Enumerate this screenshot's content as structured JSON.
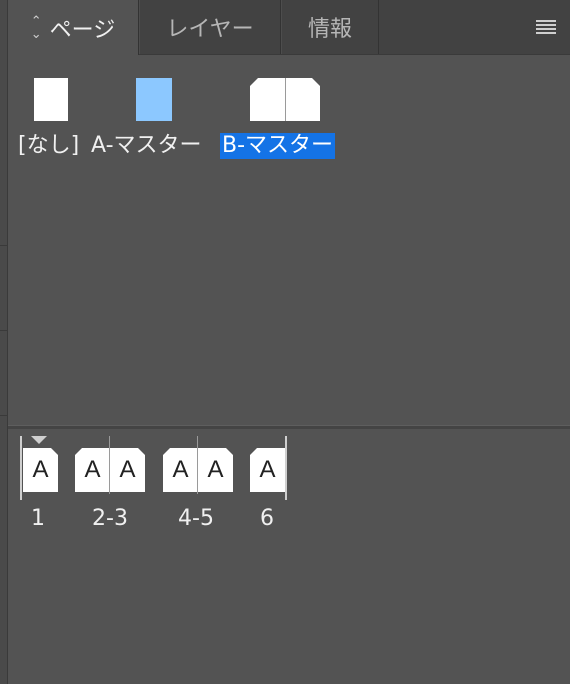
{
  "tabs": [
    {
      "label": "ページ",
      "active": true
    },
    {
      "label": "レイヤー",
      "active": false
    },
    {
      "label": "情報",
      "active": false
    }
  ],
  "tab_sort_icon": "up-down-chevron-icon",
  "panel_menu_icon": "hamburger-menu-icon",
  "masters": [
    {
      "label": "[なし]",
      "color": "#ffffff",
      "spread": false,
      "selected": false
    },
    {
      "label": "A-マスター",
      "color": "#8cc8ff",
      "spread": false,
      "selected": false
    },
    {
      "label": "B-マスター",
      "color": "#ffffff",
      "spread": true,
      "selected": true
    }
  ],
  "pages": [
    {
      "label": "1",
      "thumbs": [
        "A"
      ]
    },
    {
      "label": "2-3",
      "thumbs": [
        "A",
        "A"
      ]
    },
    {
      "label": "4-5",
      "thumbs": [
        "A",
        "A"
      ]
    },
    {
      "label": "6",
      "thumbs": [
        "A"
      ]
    }
  ],
  "colors": {
    "selection": "#1473e6",
    "master_a_page": "#8cc8ff"
  }
}
